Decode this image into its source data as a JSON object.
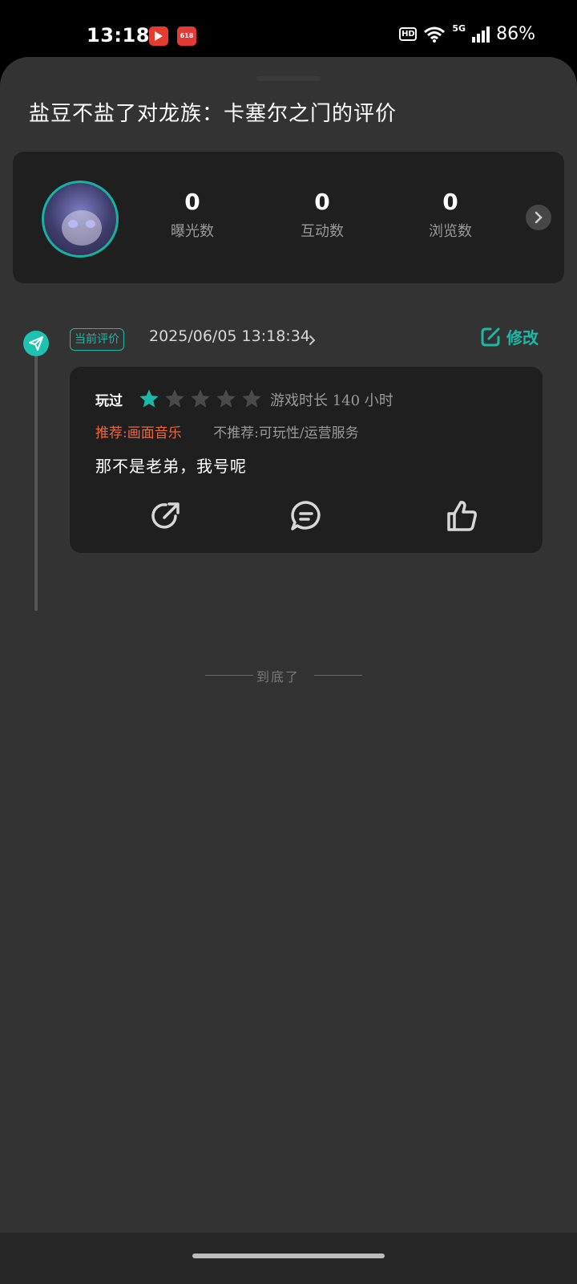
{
  "status_bar": {
    "time": "13:18",
    "network": "5G",
    "battery": "86%",
    "hd_label": "HD"
  },
  "sheet": {
    "title": "盐豆不盐了对龙族：卡塞尔之门的评价"
  },
  "stats": {
    "items": [
      {
        "value": "0",
        "label": "曝光数"
      },
      {
        "value": "0",
        "label": "互动数"
      },
      {
        "value": "0",
        "label": "浏览数"
      }
    ]
  },
  "review": {
    "current_badge": "当前评价",
    "datetime": "2025/06/05 13:18:34",
    "edit_label": "修改",
    "played_label": "玩过",
    "rating": 1,
    "rating_max": 5,
    "playtime": "游戏时长 140 小时",
    "recommend": "推荐:画面音乐",
    "not_recommend": "不推荐:可玩性/运营服务",
    "text": "那不是老弟，我号呢"
  },
  "footer": {
    "end_text": "到底了"
  },
  "colors": {
    "accent": "#1cb7a7",
    "recommend": "#e8673e",
    "sheet_bg": "#333333",
    "card_bg": "#1f1f1f"
  }
}
